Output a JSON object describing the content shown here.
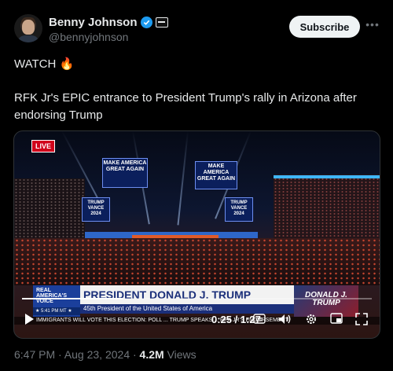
{
  "author": {
    "display_name": "Benny Johnson",
    "handle": "@bennyjohnson",
    "avatar_icon": "avatar-portrait",
    "verified_icon": "verified-badge-icon",
    "verified_color": "#1d9bf0",
    "affiliation_icon": "organization-badge-icon"
  },
  "actions": {
    "subscribe_label": "Subscribe",
    "more_icon": "more-options-icon"
  },
  "post": {
    "watch_text": "WATCH 🔥",
    "body": "RFK Jr's EPIC entrance to President Trump's rally in Arizona after endorsing Trump"
  },
  "video": {
    "live_badge": "LIVE",
    "screen_left": "MAKE AMERICA GREAT AGAIN",
    "screen_right": "MAKE AMERICA GREAT AGAIN",
    "side_screen_left": "TRUMP VANCE 2024",
    "side_screen_right": "TRUMP VANCE 2024",
    "network_logo": "REAL AMERICA'S VOICE",
    "network_time": "★ 5:41 PM MT ★",
    "lower_third_title": "PRESIDENT DONALD J. TRUMP",
    "lower_third_subtitle": "45th President of the United States of America",
    "lower_third_thumb": "DONALD J. TRUMP",
    "ticker": "IMMIGRANTS WILL VOTE THIS ELECTION: POLL ... TRUMP SPEAKS ... RFK JR'S ENDORSEMENT",
    "time_display": "0:25 / 1:27",
    "progress_fraction": 0.287,
    "control_icons": [
      "play-icon",
      "captions-icon",
      "volume-icon",
      "settings-icon",
      "fullscreen-icon"
    ]
  },
  "footer": {
    "timestamp": "6:47 PM · Aug 23, 2024 ·",
    "views_count": "4.2M",
    "views_label": "Views"
  },
  "colors": {
    "background": "#000000",
    "accent": "#1d9bf0",
    "muted_text": "#71767b",
    "live_red": "#d0021b"
  }
}
